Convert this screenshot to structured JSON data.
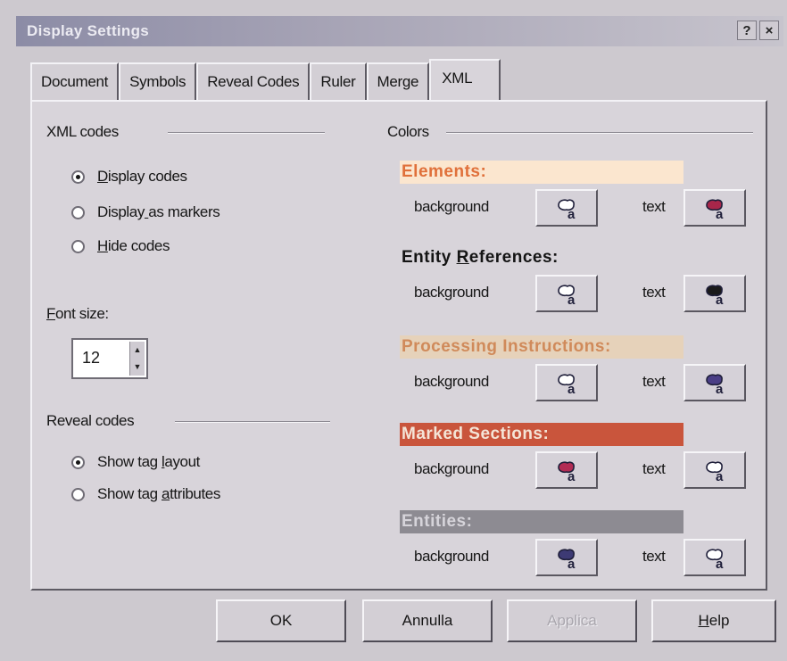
{
  "window": {
    "title": "Display Settings",
    "help_glyph": "?",
    "close_glyph": "×"
  },
  "tabs": [
    {
      "label": "Document"
    },
    {
      "label": "Symbols"
    },
    {
      "label": "Reveal Codes"
    },
    {
      "label": "Ruler"
    },
    {
      "label": "Merge"
    },
    {
      "label": "XML",
      "active": true
    }
  ],
  "xml_codes": {
    "group_label": "XML codes",
    "options": [
      {
        "label": "Display codes",
        "selected": true
      },
      {
        "label": "Display as markers",
        "selected": false
      },
      {
        "label": "Hide codes",
        "selected": false
      }
    ]
  },
  "font_size": {
    "label": "Font size:",
    "value": "12"
  },
  "reveal_codes": {
    "group_label": "Reveal codes",
    "options": [
      {
        "label": "Show tag layout",
        "selected": true
      },
      {
        "label": "Show tag attributes",
        "selected": false
      }
    ]
  },
  "colors": {
    "group_label": "Colors",
    "background_label": "background",
    "text_label": "text",
    "categories": [
      {
        "label": "Elements:",
        "text_color": "#e0703a",
        "bg_color": "#fbe6cf",
        "bg_icon_color": "#ffffff",
        "text_icon_color": "#a8264a"
      },
      {
        "label": "Entity References:",
        "text_color": "#141414",
        "bg_color": "",
        "bg_icon_color": "#ffffff",
        "text_icon_color": "#1a1a1a"
      },
      {
        "label": "Processing Instructions:",
        "text_color": "#d08a5a",
        "bg_color": "#e6d2ba",
        "bg_icon_color": "#ffffff",
        "text_icon_color": "#4a3e86"
      },
      {
        "label": "Marked Sections:",
        "text_color": "#f4e4d6",
        "bg_color": "#c9553c",
        "bg_icon_color": "#b22c54",
        "text_icon_color": "#ffffff"
      },
      {
        "label": "Entities:",
        "text_color": "#d6d4da",
        "bg_color": "#8d8b92",
        "bg_icon_color": "#3d3a74",
        "text_icon_color": "#ffffff"
      }
    ]
  },
  "buttons": {
    "ok": "OK",
    "cancel": "Annulla",
    "apply": "Applica",
    "help": "Help"
  }
}
